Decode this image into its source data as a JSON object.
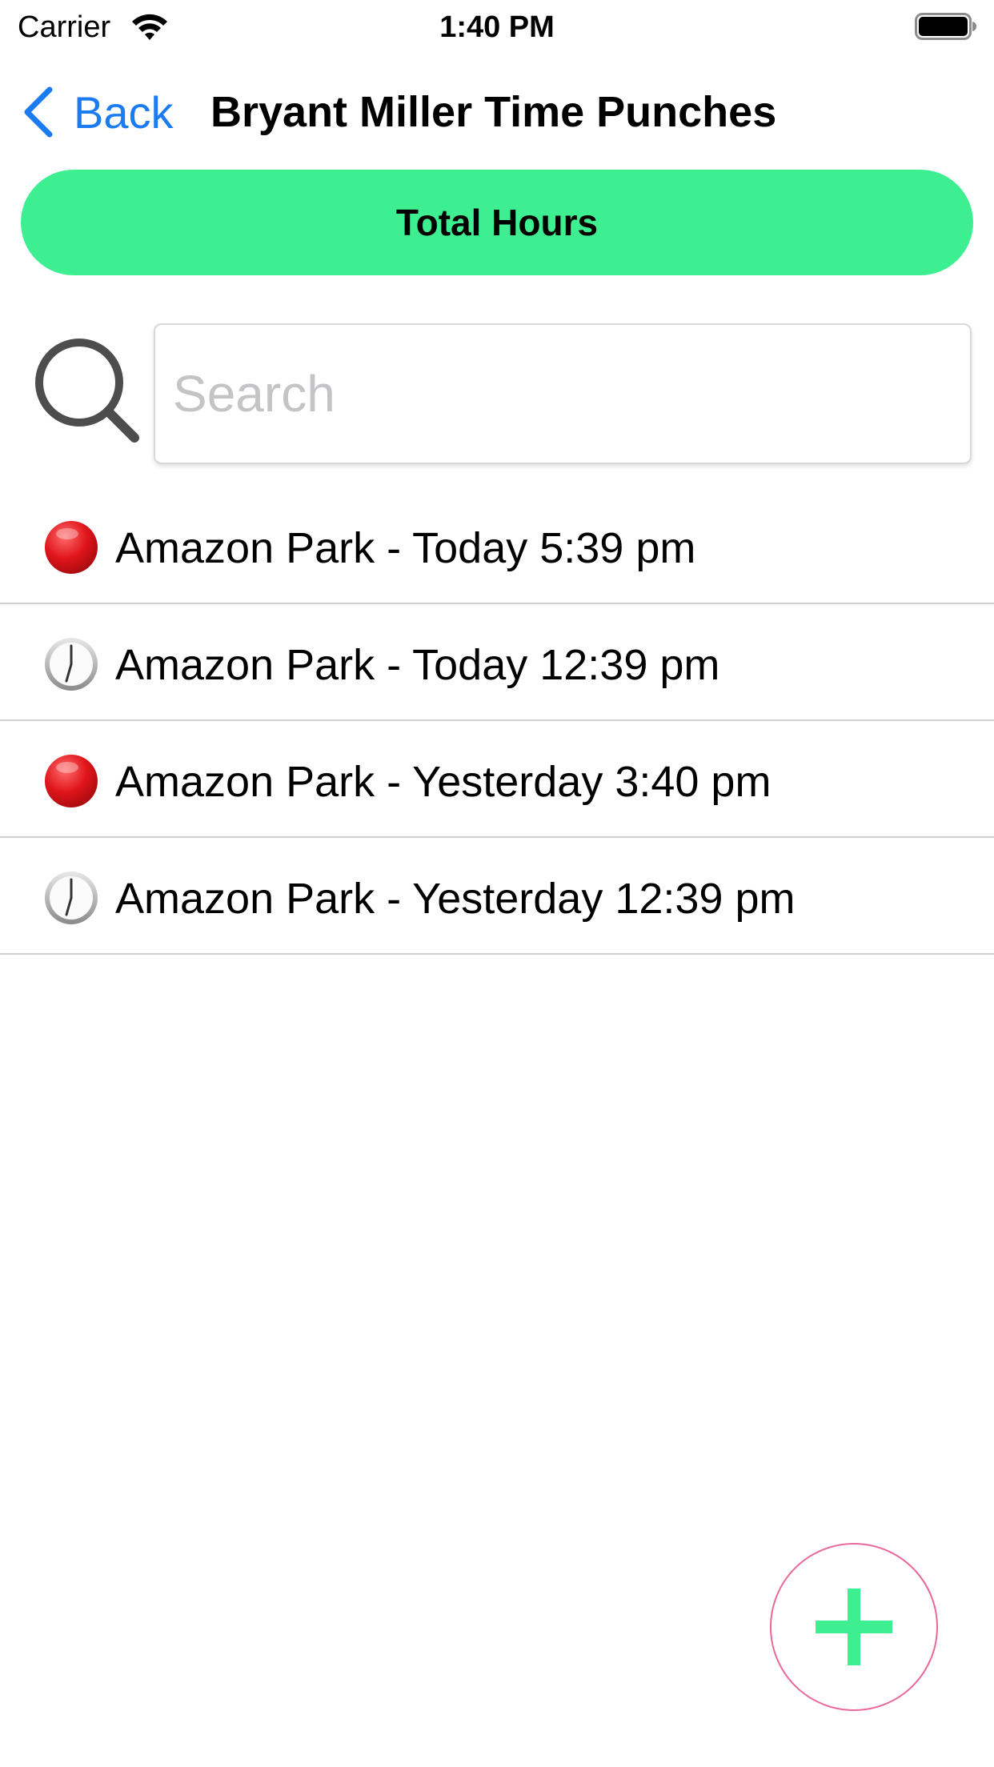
{
  "status_bar": {
    "carrier": "Carrier",
    "time": "1:40 PM",
    "wifi_icon": "wifi-icon",
    "battery_icon": "battery-full-icon"
  },
  "nav": {
    "back_label": "Back",
    "back_icon": "chevron-left-icon",
    "title": "Bryant Miller Time Punches"
  },
  "total_hours_button": {
    "label": "Total Hours",
    "color": "#3def91"
  },
  "search": {
    "icon": "search-icon",
    "placeholder": "Search",
    "value": ""
  },
  "punches": [
    {
      "icon": "red-circle-icon",
      "text": "Amazon Park - Today 5:39 pm"
    },
    {
      "icon": "clock-icon",
      "text": "Amazon Park - Today 12:39 pm"
    },
    {
      "icon": "red-circle-icon",
      "text": "Amazon Park - Yesterday 3:40 pm"
    },
    {
      "icon": "clock-icon",
      "text": "Amazon Park - Yesterday 12:39 pm"
    }
  ],
  "add_button": {
    "icon": "plus-icon",
    "plus_color": "#3def91",
    "border_color": "#e8699a"
  },
  "colors": {
    "accent_blue": "#1b7cf2",
    "red_dot": "#d9141a"
  }
}
